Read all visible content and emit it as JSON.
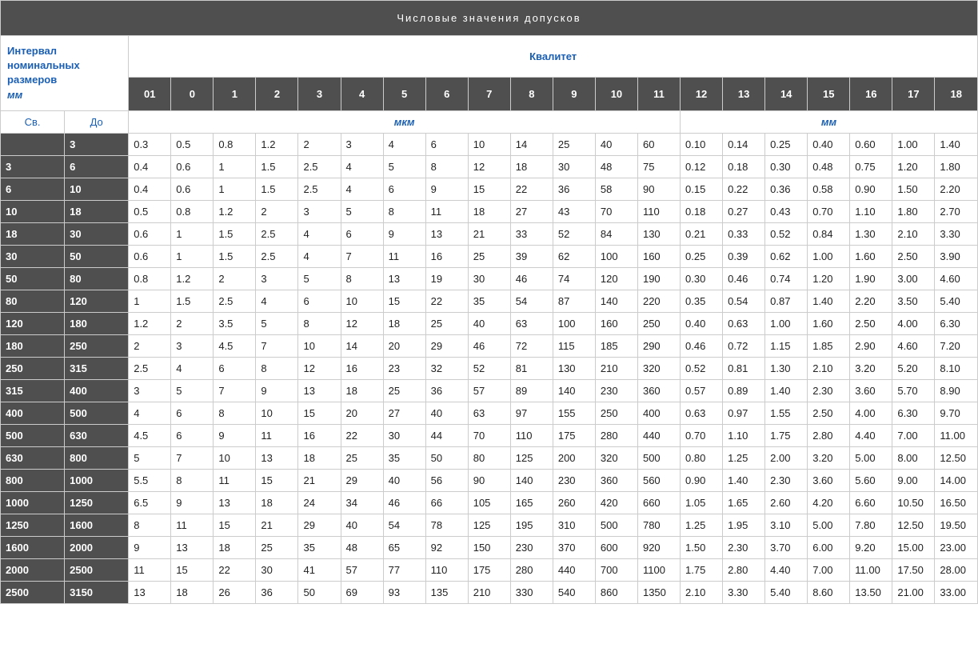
{
  "title": "Числовые значения допусков",
  "interval_label_line1": "Интервал",
  "interval_label_line2": "номинальных",
  "interval_label_line3": "размеров",
  "interval_unit": "мм",
  "kvalitet_label": "Квалитет",
  "grades": [
    "01",
    "0",
    "1",
    "2",
    "3",
    "4",
    "5",
    "6",
    "7",
    "8",
    "9",
    "10",
    "11",
    "12",
    "13",
    "14",
    "15",
    "16",
    "17",
    "18"
  ],
  "sv_label": "Св.",
  "do_label": "До",
  "unit_mkm": "мкм",
  "unit_mm": "мм",
  "rows": [
    {
      "from": "",
      "to": "3",
      "v": [
        "0.3",
        "0.5",
        "0.8",
        "1.2",
        "2",
        "3",
        "4",
        "6",
        "10",
        "14",
        "25",
        "40",
        "60",
        "0.10",
        "0.14",
        "0.25",
        "0.40",
        "0.60",
        "1.00",
        "1.40"
      ]
    },
    {
      "from": "3",
      "to": "6",
      "v": [
        "0.4",
        "0.6",
        "1",
        "1.5",
        "2.5",
        "4",
        "5",
        "8",
        "12",
        "18",
        "30",
        "48",
        "75",
        "0.12",
        "0.18",
        "0.30",
        "0.48",
        "0.75",
        "1.20",
        "1.80"
      ]
    },
    {
      "from": "6",
      "to": "10",
      "v": [
        "0.4",
        "0.6",
        "1",
        "1.5",
        "2.5",
        "4",
        "6",
        "9",
        "15",
        "22",
        "36",
        "58",
        "90",
        "0.15",
        "0.22",
        "0.36",
        "0.58",
        "0.90",
        "1.50",
        "2.20"
      ]
    },
    {
      "from": "10",
      "to": "18",
      "v": [
        "0.5",
        "0.8",
        "1.2",
        "2",
        "3",
        "5",
        "8",
        "11",
        "18",
        "27",
        "43",
        "70",
        "110",
        "0.18",
        "0.27",
        "0.43",
        "0.70",
        "1.10",
        "1.80",
        "2.70"
      ]
    },
    {
      "from": "18",
      "to": "30",
      "v": [
        "0.6",
        "1",
        "1.5",
        "2.5",
        "4",
        "6",
        "9",
        "13",
        "21",
        "33",
        "52",
        "84",
        "130",
        "0.21",
        "0.33",
        "0.52",
        "0.84",
        "1.30",
        "2.10",
        "3.30"
      ]
    },
    {
      "from": "30",
      "to": "50",
      "v": [
        "0.6",
        "1",
        "1.5",
        "2.5",
        "4",
        "7",
        "11",
        "16",
        "25",
        "39",
        "62",
        "100",
        "160",
        "0.25",
        "0.39",
        "0.62",
        "1.00",
        "1.60",
        "2.50",
        "3.90"
      ]
    },
    {
      "from": "50",
      "to": "80",
      "v": [
        "0.8",
        "1.2",
        "2",
        "3",
        "5",
        "8",
        "13",
        "19",
        "30",
        "46",
        "74",
        "120",
        "190",
        "0.30",
        "0.46",
        "0.74",
        "1.20",
        "1.90",
        "3.00",
        "4.60"
      ]
    },
    {
      "from": "80",
      "to": "120",
      "v": [
        "1",
        "1.5",
        "2.5",
        "4",
        "6",
        "10",
        "15",
        "22",
        "35",
        "54",
        "87",
        "140",
        "220",
        "0.35",
        "0.54",
        "0.87",
        "1.40",
        "2.20",
        "3.50",
        "5.40"
      ]
    },
    {
      "from": "120",
      "to": "180",
      "v": [
        "1.2",
        "2",
        "3.5",
        "5",
        "8",
        "12",
        "18",
        "25",
        "40",
        "63",
        "100",
        "160",
        "250",
        "0.40",
        "0.63",
        "1.00",
        "1.60",
        "2.50",
        "4.00",
        "6.30"
      ]
    },
    {
      "from": "180",
      "to": "250",
      "v": [
        "2",
        "3",
        "4.5",
        "7",
        "10",
        "14",
        "20",
        "29",
        "46",
        "72",
        "115",
        "185",
        "290",
        "0.46",
        "0.72",
        "1.15",
        "1.85",
        "2.90",
        "4.60",
        "7.20"
      ]
    },
    {
      "from": "250",
      "to": "315",
      "v": [
        "2.5",
        "4",
        "6",
        "8",
        "12",
        "16",
        "23",
        "32",
        "52",
        "81",
        "130",
        "210",
        "320",
        "0.52",
        "0.81",
        "1.30",
        "2.10",
        "3.20",
        "5.20",
        "8.10"
      ]
    },
    {
      "from": "315",
      "to": "400",
      "v": [
        "3",
        "5",
        "7",
        "9",
        "13",
        "18",
        "25",
        "36",
        "57",
        "89",
        "140",
        "230",
        "360",
        "0.57",
        "0.89",
        "1.40",
        "2.30",
        "3.60",
        "5.70",
        "8.90"
      ]
    },
    {
      "from": "400",
      "to": "500",
      "v": [
        "4",
        "6",
        "8",
        "10",
        "15",
        "20",
        "27",
        "40",
        "63",
        "97",
        "155",
        "250",
        "400",
        "0.63",
        "0.97",
        "1.55",
        "2.50",
        "4.00",
        "6.30",
        "9.70"
      ]
    },
    {
      "from": "500",
      "to": "630",
      "v": [
        "4.5",
        "6",
        "9",
        "11",
        "16",
        "22",
        "30",
        "44",
        "70",
        "110",
        "175",
        "280",
        "440",
        "0.70",
        "1.10",
        "1.75",
        "2.80",
        "4.40",
        "7.00",
        "11.00"
      ]
    },
    {
      "from": "630",
      "to": "800",
      "v": [
        "5",
        "7",
        "10",
        "13",
        "18",
        "25",
        "35",
        "50",
        "80",
        "125",
        "200",
        "320",
        "500",
        "0.80",
        "1.25",
        "2.00",
        "3.20",
        "5.00",
        "8.00",
        "12.50"
      ]
    },
    {
      "from": "800",
      "to": "1000",
      "v": [
        "5.5",
        "8",
        "11",
        "15",
        "21",
        "29",
        "40",
        "56",
        "90",
        "140",
        "230",
        "360",
        "560",
        "0.90",
        "1.40",
        "2.30",
        "3.60",
        "5.60",
        "9.00",
        "14.00"
      ]
    },
    {
      "from": "1000",
      "to": "1250",
      "v": [
        "6.5",
        "9",
        "13",
        "18",
        "24",
        "34",
        "46",
        "66",
        "105",
        "165",
        "260",
        "420",
        "660",
        "1.05",
        "1.65",
        "2.60",
        "4.20",
        "6.60",
        "10.50",
        "16.50"
      ]
    },
    {
      "from": "1250",
      "to": "1600",
      "v": [
        "8",
        "11",
        "15",
        "21",
        "29",
        "40",
        "54",
        "78",
        "125",
        "195",
        "310",
        "500",
        "780",
        "1.25",
        "1.95",
        "3.10",
        "5.00",
        "7.80",
        "12.50",
        "19.50"
      ]
    },
    {
      "from": "1600",
      "to": "2000",
      "v": [
        "9",
        "13",
        "18",
        "25",
        "35",
        "48",
        "65",
        "92",
        "150",
        "230",
        "370",
        "600",
        "920",
        "1.50",
        "2.30",
        "3.70",
        "6.00",
        "9.20",
        "15.00",
        "23.00"
      ]
    },
    {
      "from": "2000",
      "to": "2500",
      "v": [
        "11",
        "15",
        "22",
        "30",
        "41",
        "57",
        "77",
        "110",
        "175",
        "280",
        "440",
        "700",
        "1100",
        "1.75",
        "2.80",
        "4.40",
        "7.00",
        "11.00",
        "17.50",
        "28.00"
      ]
    },
    {
      "from": "2500",
      "to": "3150",
      "v": [
        "13",
        "18",
        "26",
        "36",
        "50",
        "69",
        "93",
        "135",
        "210",
        "330",
        "540",
        "860",
        "1350",
        "2.10",
        "3.30",
        "5.40",
        "8.60",
        "13.50",
        "21.00",
        "33.00"
      ]
    }
  ]
}
